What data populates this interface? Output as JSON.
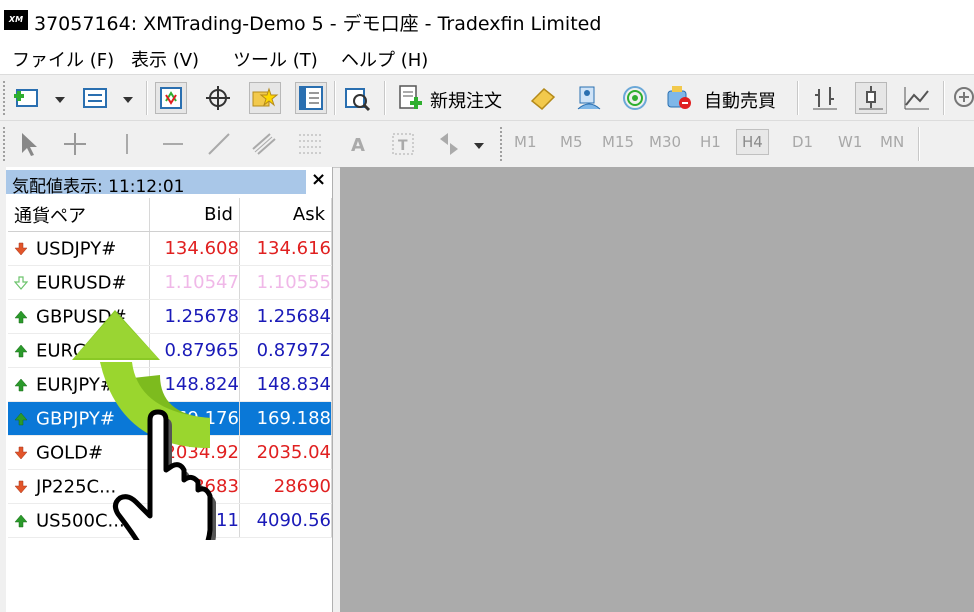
{
  "window": {
    "title": "37057164: XMTrading-Demo 5 - デモ口座 - Tradexfin Limited",
    "logo_text": "XM"
  },
  "menu": [
    {
      "label": "ファイル (F)"
    },
    {
      "label": "表示 (V)"
    },
    {
      "label": "ツール (T)"
    },
    {
      "label": "ヘルプ (H)"
    }
  ],
  "toolbar": {
    "new_order_label": "新規注文",
    "autotrading_label": "自動売買"
  },
  "timeframes": [
    "M1",
    "M5",
    "M15",
    "M30",
    "H1",
    "H4",
    "D1",
    "W1",
    "MN"
  ],
  "active_timeframe": "H4",
  "market_watch": {
    "title": "気配値表示: 11:12:01",
    "close": "×",
    "columns": {
      "symbol": "通貨ペア",
      "bid": "Bid",
      "ask": "Ask"
    },
    "rows": [
      {
        "symbol": "USDJPY#",
        "bid": "134.608",
        "ask": "134.616",
        "direction": "down",
        "color": "#e02020"
      },
      {
        "symbol": "EURUSD#",
        "bid": "1.10547",
        "ask": "1.10555",
        "direction": "none",
        "color": "#f0b8e8"
      },
      {
        "symbol": "GBPUSD#",
        "bid": "1.25678",
        "ask": "1.25684",
        "direction": "up",
        "color": "#1a1ab8"
      },
      {
        "symbol": "EURGBP#",
        "bid": "0.87965",
        "ask": "0.87972",
        "direction": "up",
        "color": "#1a1ab8"
      },
      {
        "symbol": "EURJPY#",
        "bid": "148.824",
        "ask": "148.834",
        "direction": "up",
        "color": "#1a1ab8"
      },
      {
        "symbol": "GBPJPY#",
        "bid": "169.176",
        "ask": "169.188",
        "direction": "up",
        "color": "#1a1ab8",
        "selected": true
      },
      {
        "symbol": "GOLD#",
        "bid": "2034.92",
        "ask": "2035.04",
        "direction": "down",
        "color": "#e02020"
      },
      {
        "symbol": "JP225C...",
        "bid": "28683",
        "ask": "28690",
        "direction": "down",
        "color": "#e02020"
      },
      {
        "symbol": "US500C...",
        "bid": "4090.11",
        "ask": "4090.56",
        "direction": "up",
        "color": "#1a1ab8"
      }
    ]
  },
  "colors": {
    "selection": "#0a78d7",
    "header": "#a9c7e8",
    "chart_bg": "#ababab",
    "pointer_arrow": "#8ac926"
  }
}
